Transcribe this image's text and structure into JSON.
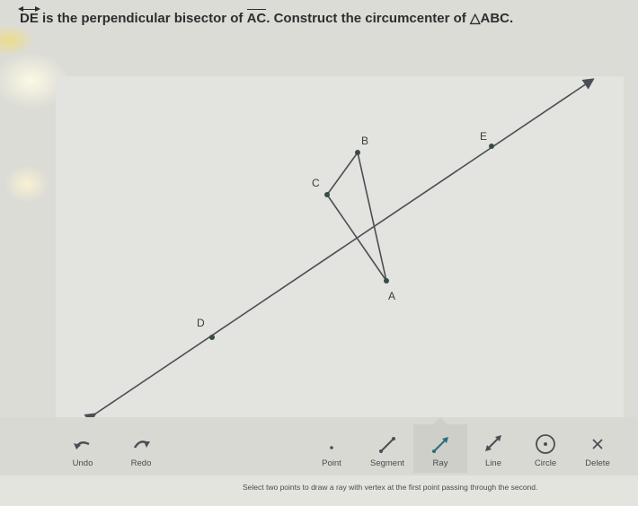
{
  "prompt": {
    "line_name": "DE",
    "text_1": " is the perpendicular bisector of ",
    "segment_name": "AC",
    "text_2": ". Construct the circumcenter of ",
    "triangle_symbol": "△",
    "triangle_name": "ABC",
    "text_3": "."
  },
  "canvas": {
    "points": {
      "A": "A",
      "B": "B",
      "C": "C",
      "D": "D",
      "E": "E"
    }
  },
  "toolbar": {
    "undo": "Undo",
    "redo": "Redo",
    "point": "Point",
    "segment": "Segment",
    "ray": "Ray",
    "line": "Line",
    "circle": "Circle",
    "delete": "Delete",
    "active_tool": "Ray"
  },
  "status": {
    "text": "Select two points to draw a ray with vertex at the first point passing through the second."
  },
  "colors": {
    "stroke": "#4a4f55",
    "point": "#3a4a46",
    "background": "#e3e3df"
  }
}
